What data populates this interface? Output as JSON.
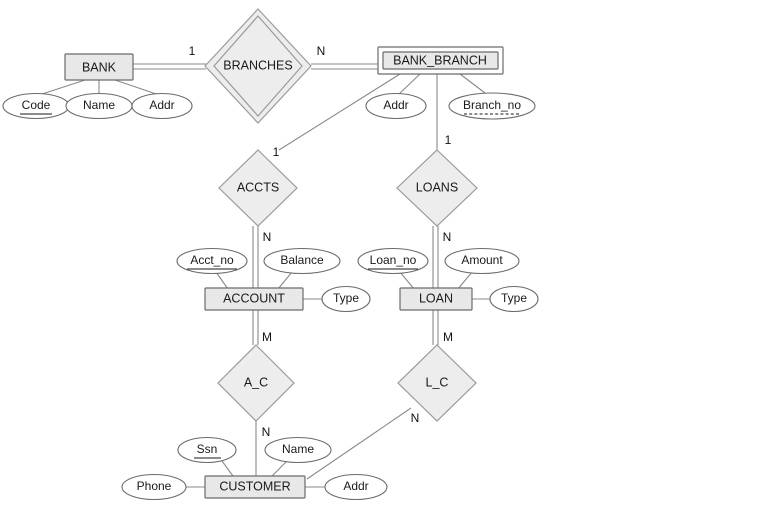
{
  "diagram": {
    "title": "BANK ER Diagram",
    "type": "entity-relationship-diagram",
    "background_color": "#ffffff",
    "entity_fill": "#e8e8e8",
    "relationship_fill": "#ededed",
    "attribute_fill": "#ffffff",
    "line_color": "#8a8a8a"
  },
  "entities": [
    {
      "id": "bank",
      "label": "BANK",
      "kind": "strong",
      "attributes": [
        {
          "label": "Code",
          "key": "primary"
        },
        {
          "label": "Name",
          "key": "none"
        },
        {
          "label": "Addr",
          "key": "none"
        }
      ]
    },
    {
      "id": "bank_branch",
      "label": "BANK_BRANCH",
      "kind": "weak",
      "attributes": [
        {
          "label": "Addr",
          "key": "none"
        },
        {
          "label": "Branch_no",
          "key": "partial"
        }
      ]
    },
    {
      "id": "account",
      "label": "ACCOUNT",
      "kind": "strong",
      "attributes": [
        {
          "label": "Acct_no",
          "key": "primary"
        },
        {
          "label": "Balance",
          "key": "none"
        },
        {
          "label": "Type",
          "key": "none"
        }
      ]
    },
    {
      "id": "loan",
      "label": "LOAN",
      "kind": "strong",
      "attributes": [
        {
          "label": "Loan_no",
          "key": "primary"
        },
        {
          "label": "Amount",
          "key": "none"
        },
        {
          "label": "Type",
          "key": "none"
        }
      ]
    },
    {
      "id": "customer",
      "label": "CUSTOMER",
      "kind": "strong",
      "attributes": [
        {
          "label": "Ssn",
          "key": "primary"
        },
        {
          "label": "Name",
          "key": "none"
        },
        {
          "label": "Phone",
          "key": "none"
        },
        {
          "label": "Addr",
          "key": "none"
        }
      ]
    }
  ],
  "relationships": [
    {
      "id": "branches",
      "label": "BRANCHES",
      "kind": "identifying",
      "left_cardinality": "1",
      "right_cardinality": "N",
      "from": "BANK",
      "to": "BANK_BRANCH"
    },
    {
      "id": "accts",
      "label": "ACCTS",
      "kind": "regular",
      "top_cardinality": "1",
      "bottom_cardinality": "N",
      "from": "BANK_BRANCH",
      "to": "ACCOUNT"
    },
    {
      "id": "loans",
      "label": "LOANS",
      "kind": "regular",
      "top_cardinality": "1",
      "bottom_cardinality": "N",
      "from": "BANK_BRANCH",
      "to": "LOAN"
    },
    {
      "id": "a_c",
      "label": "A_C",
      "kind": "regular",
      "top_cardinality": "M",
      "bottom_cardinality": "N",
      "from": "ACCOUNT",
      "to": "CUSTOMER"
    },
    {
      "id": "l_c",
      "label": "L_C",
      "kind": "regular",
      "top_cardinality": "M",
      "bottom_cardinality": "N",
      "from": "LOAN",
      "to": "CUSTOMER"
    }
  ],
  "labels": {
    "bank": "BANK",
    "bank_code": "Code",
    "bank_name": "Name",
    "bank_addr": "Addr",
    "branches": "BRANCHES",
    "branches_left_card": "1",
    "branches_right_card": "N",
    "bank_branch": "BANK_BRANCH",
    "branch_addr": "Addr",
    "branch_no": "Branch_no",
    "accts": "ACCTS",
    "accts_top_card": "1",
    "accts_bottom_card": "N",
    "loans": "LOANS",
    "loans_top_card": "1",
    "loans_bottom_card": "N",
    "account": "ACCOUNT",
    "acct_no": "Acct_no",
    "balance": "Balance",
    "account_type": "Type",
    "loan": "LOAN",
    "loan_no": "Loan_no",
    "amount": "Amount",
    "loan_type": "Type",
    "a_c": "A_C",
    "a_c_top_card": "M",
    "a_c_bottom_card": "N",
    "l_c": "L_C",
    "l_c_top_card": "M",
    "l_c_bottom_card": "N",
    "customer": "CUSTOMER",
    "ssn": "Ssn",
    "cust_name": "Name",
    "phone": "Phone",
    "cust_addr": "Addr"
  }
}
